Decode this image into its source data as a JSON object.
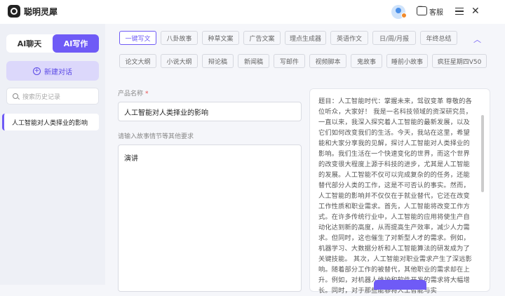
{
  "app": {
    "title": "聪明灵犀"
  },
  "header": {
    "customer_service_label": "客服"
  },
  "sidebar": {
    "modes": [
      {
        "label": "AI聊天",
        "active": false
      },
      {
        "label": "AI写作",
        "active": true
      }
    ],
    "new_chat_label": "新建对话",
    "search_placeholder": "搜索历史记录",
    "history": [
      {
        "label": "人工智能对人类择业的影响"
      }
    ]
  },
  "tags": [
    {
      "label": "一键写文",
      "active": true
    },
    {
      "label": "八卦故事",
      "active": false
    },
    {
      "label": "种草文案",
      "active": false
    },
    {
      "label": "广告文案",
      "active": false
    },
    {
      "label": "理点生成器",
      "active": false
    },
    {
      "label": "英语作文",
      "active": false
    },
    {
      "label": "日/周/月报",
      "active": false
    },
    {
      "label": "年终总结",
      "active": false
    },
    {
      "label": "论文大纲",
      "active": false
    },
    {
      "label": "小说大纲",
      "active": false
    },
    {
      "label": "辩论稿",
      "active": false
    },
    {
      "label": "新闻稿",
      "active": false
    },
    {
      "label": "写邮件",
      "active": false
    },
    {
      "label": "视频脚本",
      "active": false
    },
    {
      "label": "鬼故事",
      "active": false
    },
    {
      "label": "睡前小故事",
      "active": false
    },
    {
      "label": "疯狂星期四V50",
      "active": false
    }
  ],
  "form": {
    "product_label": "产品名称",
    "required_mark": "*",
    "product_value": "人工智能对人类择业的影响",
    "requirements_label": "请输入故事情节等其他要求",
    "requirements_value": "演讲"
  },
  "output": {
    "text": "题目：人工智能时代：掌握未来，驾驭变革 尊敬的各位听众，大家好！ 我是一名科技领域的资深研究员，一直以来，我深入探究着人工智能的最新发展，以及它们如何改变我们的生活。今天，我站在这里，希望能和大家分享我的见解，探讨人工智能对人类择业的影响。我们生活在一个快速变化的世界，而这个世界的改变很大程度上源于科技的进步，尤其是人工智能的发展。人工智能不仅可以完成复杂的的任务，还能替代部分人类的工作，这是不可否认的事实。然而，人工智能的影响并不仅仅在于就业替代，它还在改变工作性质和职业需求。首先，人工智能将改变工作方式。在许多传统行业中，人工智能的应用将使生产自动化达到新的高度，从而提高生产效率，减少人力需求。但同时，这也催生了对新型人才的需求。例如，机器学习、大数据分析和人工智能算法的研发成为了关键技能。 其次，人工智能对职业需求产生了深远影响。随着部分工作的被替代，其他职业的需求却在上升。例如，对机器人维护和软件开发的需求将大幅增长。同时，对于那些能够将人工智能与实"
  }
}
